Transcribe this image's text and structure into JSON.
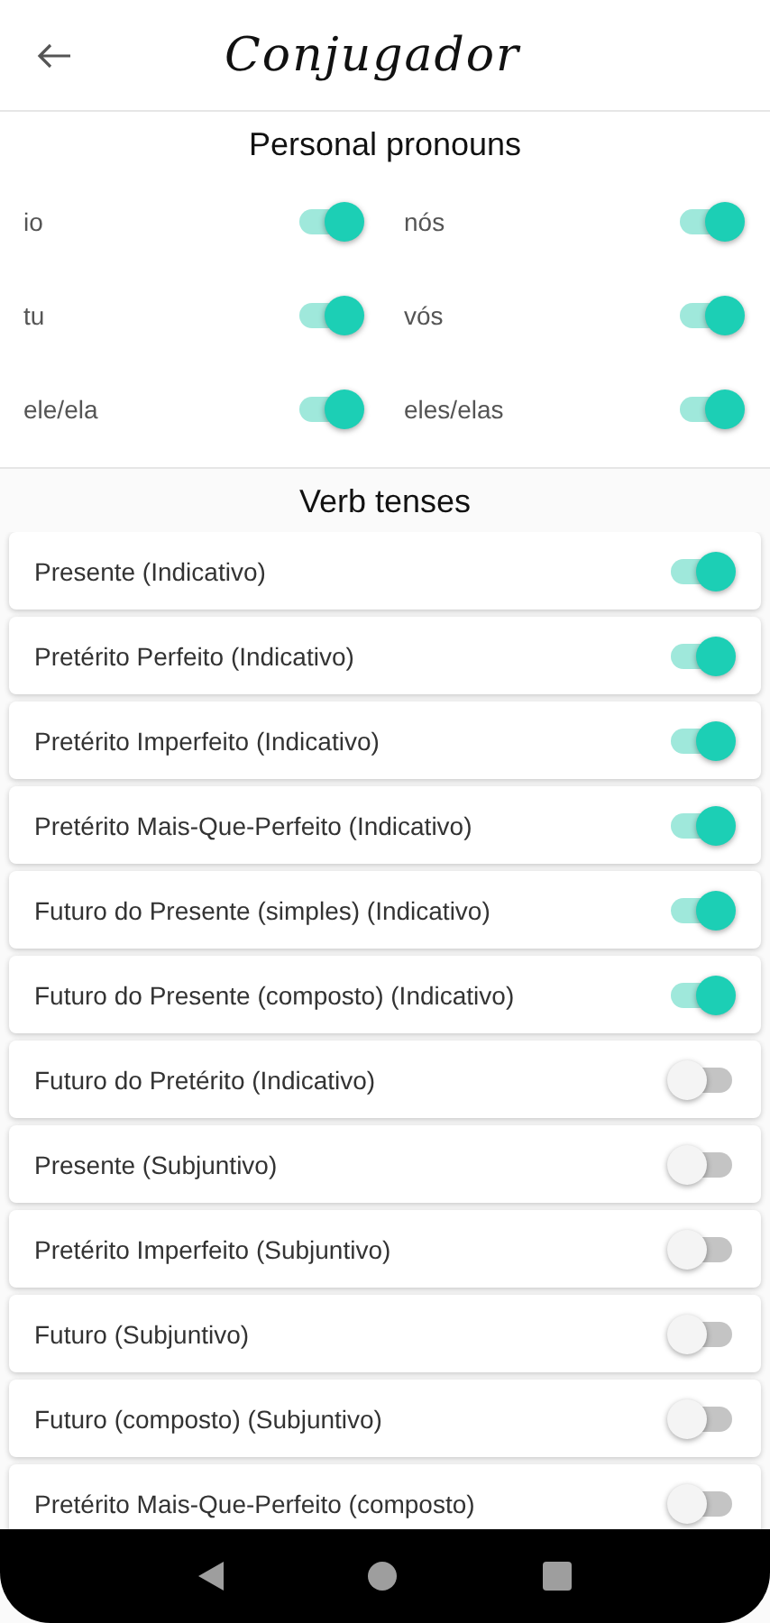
{
  "header": {
    "title": "Conjugador"
  },
  "pronouns": {
    "title": "Personal pronouns",
    "items": [
      {
        "label": "io",
        "on": true
      },
      {
        "label": "nós",
        "on": true
      },
      {
        "label": "tu",
        "on": true
      },
      {
        "label": "vós",
        "on": true
      },
      {
        "label": "ele/ela",
        "on": true
      },
      {
        "label": "eles/elas",
        "on": true
      }
    ]
  },
  "tenses": {
    "title": "Verb tenses",
    "items": [
      {
        "label": "Presente (Indicativo)",
        "on": true
      },
      {
        "label": "Pretérito Perfeito (Indicativo)",
        "on": true
      },
      {
        "label": "Pretérito Imperfeito (Indicativo)",
        "on": true
      },
      {
        "label": "Pretérito Mais-Que-Perfeito (Indicativo)",
        "on": true
      },
      {
        "label": "Futuro do Presente (simples) (Indicativo)",
        "on": true
      },
      {
        "label": "Futuro do Presente (composto) (Indicativo)",
        "on": true
      },
      {
        "label": "Futuro do Pretérito (Indicativo)",
        "on": false
      },
      {
        "label": "Presente (Subjuntivo)",
        "on": false
      },
      {
        "label": "Pretérito Imperfeito (Subjuntivo)",
        "on": false
      },
      {
        "label": "Futuro (Subjuntivo)",
        "on": false
      },
      {
        "label": "Futuro (composto) (Subjuntivo)",
        "on": false
      },
      {
        "label": "Pretérito Mais-Que-Perfeito (composto)",
        "on": false
      }
    ]
  }
}
